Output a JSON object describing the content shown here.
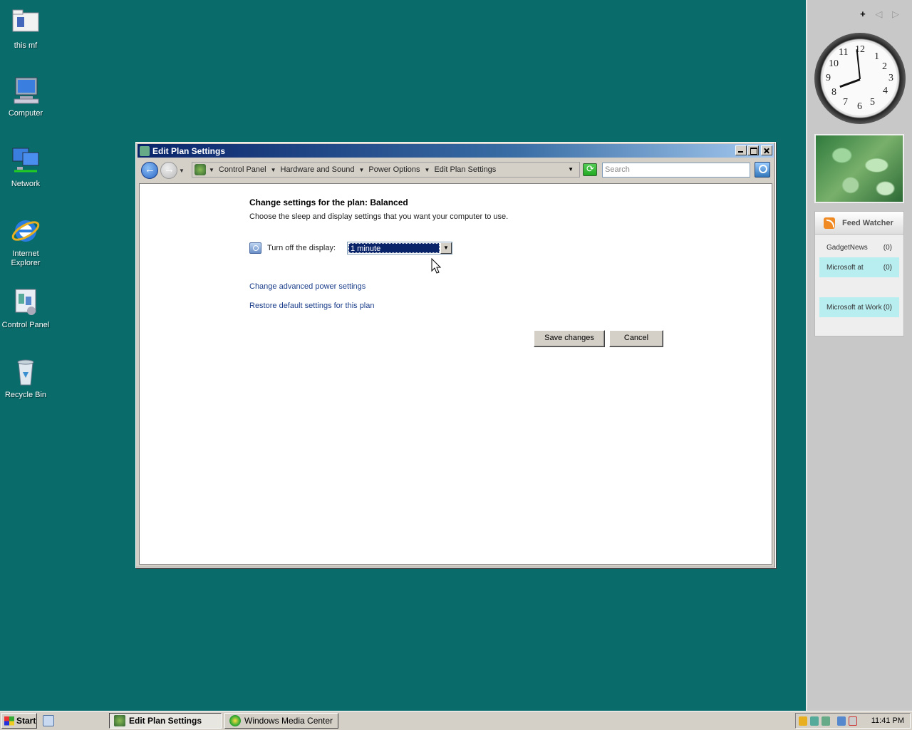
{
  "desktop": {
    "icons": [
      {
        "label": "this mf"
      },
      {
        "label": "Computer"
      },
      {
        "label": "Network"
      },
      {
        "label": "Internet Explorer"
      },
      {
        "label": "Control Panel"
      },
      {
        "label": "Recycle Bin"
      }
    ]
  },
  "sidebar": {
    "controls": {
      "add": "+",
      "prev": "◁",
      "next": "▷"
    },
    "clock": {
      "numbers": [
        "12",
        "1",
        "2",
        "3",
        "4",
        "5",
        "6",
        "7",
        "8",
        "9",
        "10",
        "11"
      ],
      "time_shown": "11:41"
    },
    "feed": {
      "title": "Feed Watcher",
      "items": [
        {
          "name": "GadgetNews",
          "count": "(0)",
          "highlight": false
        },
        {
          "name": "Microsoft at",
          "count": "(0)",
          "highlight": true
        },
        {
          "name": "Microsoft at Work",
          "count": "(0)",
          "highlight": true
        }
      ]
    }
  },
  "window": {
    "title": "Edit Plan Settings",
    "breadcrumb": [
      "Control Panel",
      "Hardware and Sound",
      "Power Options",
      "Edit Plan Settings"
    ],
    "search_placeholder": "Search",
    "heading": "Change settings for the plan: Balanced",
    "subheading": "Choose the sleep and display settings that you want your computer to use.",
    "display_label": "Turn off the display:",
    "display_value": "1 minute",
    "link_advanced": "Change advanced power settings",
    "link_restore": "Restore default settings for this plan",
    "save_label": "Save changes",
    "cancel_label": "Cancel"
  },
  "taskbar": {
    "start_label": "Start",
    "tasks": [
      {
        "label": "Edit Plan Settings",
        "active": true
      },
      {
        "label": "Windows Media Center",
        "active": false
      }
    ],
    "clock": "11:41 PM"
  }
}
